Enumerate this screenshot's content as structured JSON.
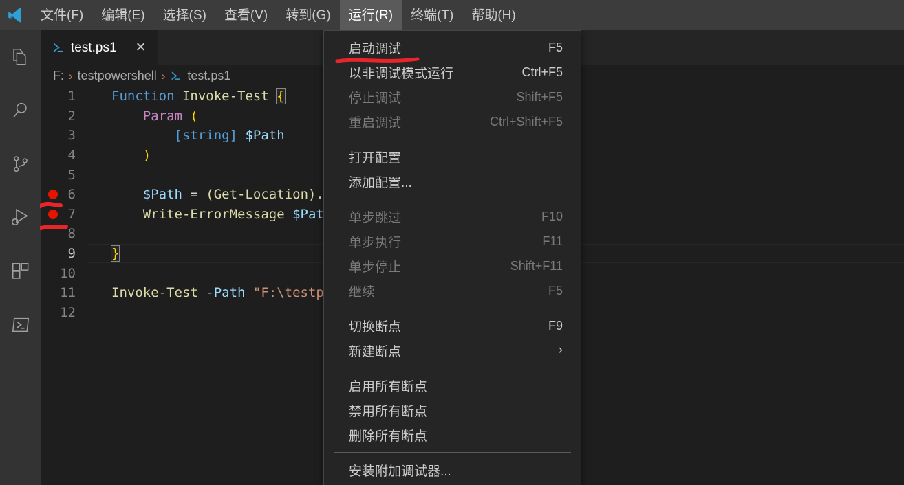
{
  "window": {
    "logo_icon": "vscode-logo-icon"
  },
  "menubar": {
    "items": [
      {
        "label": "文件(F)",
        "name": "menu-file"
      },
      {
        "label": "编辑(E)",
        "name": "menu-edit"
      },
      {
        "label": "选择(S)",
        "name": "menu-selection"
      },
      {
        "label": "查看(V)",
        "name": "menu-view"
      },
      {
        "label": "转到(G)",
        "name": "menu-go"
      },
      {
        "label": "运行(R)",
        "name": "menu-run",
        "active": true
      },
      {
        "label": "终端(T)",
        "name": "menu-terminal"
      },
      {
        "label": "帮助(H)",
        "name": "menu-help"
      }
    ]
  },
  "activitybar": {
    "items": [
      {
        "icon": "explorer-files-icon",
        "name": "activity-explorer"
      },
      {
        "icon": "search-icon",
        "name": "activity-search"
      },
      {
        "icon": "source-control-branch-icon",
        "name": "activity-source-control"
      },
      {
        "icon": "run-and-debug-icon",
        "name": "activity-run-debug"
      },
      {
        "icon": "extensions-blocks-icon",
        "name": "activity-extensions"
      },
      {
        "icon": "powershell-terminal-icon",
        "name": "activity-powershell"
      }
    ]
  },
  "editor": {
    "tab": {
      "label": "test.ps1",
      "icon": "powershell-file-icon",
      "close_icon": "close-x-icon"
    },
    "breadcrumb": {
      "parts": [
        "F:",
        "testpowershell",
        "test.ps1"
      ],
      "separator": "›",
      "file_icon": "powershell-file-icon"
    },
    "lines": [
      {
        "n": "1",
        "breakpoint": false
      },
      {
        "n": "2",
        "breakpoint": false
      },
      {
        "n": "3",
        "breakpoint": false
      },
      {
        "n": "4",
        "breakpoint": false
      },
      {
        "n": "5",
        "breakpoint": false
      },
      {
        "n": "6",
        "breakpoint": true
      },
      {
        "n": "7",
        "breakpoint": true
      },
      {
        "n": "8",
        "breakpoint": false
      },
      {
        "n": "9",
        "breakpoint": false
      },
      {
        "n": "10",
        "breakpoint": false
      },
      {
        "n": "11",
        "breakpoint": false
      },
      {
        "n": "12",
        "breakpoint": false
      }
    ],
    "code": {
      "l1_kw": "Function",
      "l1_name": "Invoke-Test",
      "l1_brace": "{",
      "l2_param": "Param",
      "l2_paren": "(",
      "l3_type": "[string]",
      "l3_var": "$Path",
      "l4_paren": ")",
      "l6_var": "$Path",
      "l6_eq": " = ",
      "l6_rest": "(Get-Location).",
      "l7_cmd": "Write-ErrorMessage",
      "l7_var": " $Pat",
      "l9_brace": "}",
      "l11_cmd": "Invoke-Test",
      "l11_param": " -Path ",
      "l11_str": "\"F:\\testp"
    }
  },
  "run_menu": {
    "groups": [
      {
        "items": [
          {
            "label": "启动调试",
            "key": "F5",
            "disabled": false,
            "name": "menu-item-start-debugging",
            "annotated": true
          },
          {
            "label": "以非调试模式运行",
            "key": "Ctrl+F5",
            "disabled": false,
            "name": "menu-item-run-without-debugging"
          },
          {
            "label": "停止调试",
            "key": "Shift+F5",
            "disabled": true,
            "name": "menu-item-stop-debugging"
          },
          {
            "label": "重启调试",
            "key": "Ctrl+Shift+F5",
            "disabled": true,
            "name": "menu-item-restart-debugging"
          }
        ]
      },
      {
        "items": [
          {
            "label": "打开配置",
            "key": "",
            "disabled": false,
            "name": "menu-item-open-configurations"
          },
          {
            "label": "添加配置...",
            "key": "",
            "disabled": false,
            "name": "menu-item-add-configuration"
          }
        ]
      },
      {
        "items": [
          {
            "label": "单步跳过",
            "key": "F10",
            "disabled": true,
            "name": "menu-item-step-over"
          },
          {
            "label": "单步执行",
            "key": "F11",
            "disabled": true,
            "name": "menu-item-step-into"
          },
          {
            "label": "单步停止",
            "key": "Shift+F11",
            "disabled": true,
            "name": "menu-item-step-out"
          },
          {
            "label": "继续",
            "key": "F5",
            "disabled": true,
            "name": "menu-item-continue"
          }
        ]
      },
      {
        "items": [
          {
            "label": "切换断点",
            "key": "F9",
            "disabled": false,
            "name": "menu-item-toggle-breakpoint"
          },
          {
            "label": "新建断点",
            "key": "",
            "arrow": "›",
            "disabled": false,
            "name": "menu-item-new-breakpoint"
          }
        ]
      },
      {
        "items": [
          {
            "label": "启用所有断点",
            "key": "",
            "disabled": false,
            "name": "menu-item-enable-all-breakpoints"
          },
          {
            "label": "禁用所有断点",
            "key": "",
            "disabled": false,
            "name": "menu-item-disable-all-breakpoints"
          },
          {
            "label": "删除所有断点",
            "key": "",
            "disabled": false,
            "name": "menu-item-remove-all-breakpoints"
          }
        ]
      },
      {
        "items": [
          {
            "label": "安装附加调试器...",
            "key": "",
            "disabled": false,
            "name": "menu-item-install-additional-debuggers"
          }
        ]
      }
    ]
  },
  "annotations": {
    "color": "#e8252a",
    "marks": [
      "underline-start-debugging",
      "gutter-mark-line6",
      "gutter-mark-line7"
    ]
  },
  "colors": {
    "titlebar_bg": "#3c3c3c",
    "activitybar_bg": "#333333",
    "editor_bg": "#1e1e1e",
    "tabbar_bg": "#252526",
    "menu_bg": "#252526",
    "menu_border": "#454545",
    "breakpoint_red": "#e51400",
    "accent_blue": "#569cd6",
    "annotation_red": "#e8252a"
  }
}
